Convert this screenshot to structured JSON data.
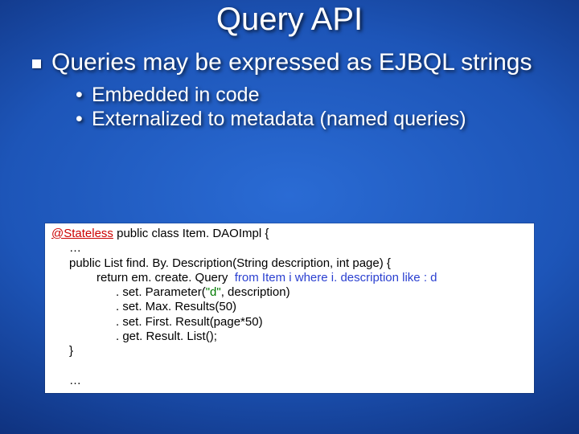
{
  "title": "Query API",
  "bullet1": "Queries may be expressed as EJBQL strings",
  "sub1": "Embedded in code",
  "sub2": "Externalized to metadata (named queries)",
  "code": {
    "l1a": "@Stateless",
    "l1b": " public class Item. DAOImpl {",
    "l2": "…",
    "l3": "public List find. By. Description(String description, int page) {",
    "l4a": "return em. create. Query",
    "l4b": "  from Item i where i. description like : d",
    "l5a": ". set. Parameter(",
    "l5b": "\"d\"",
    "l5c": ", description)",
    "l6": ". set. Max. Results(50)",
    "l7": ". set. First. Result(page*50)",
    "l8": ". get. Result. List();",
    "l9": "}",
    "l11": "…"
  }
}
